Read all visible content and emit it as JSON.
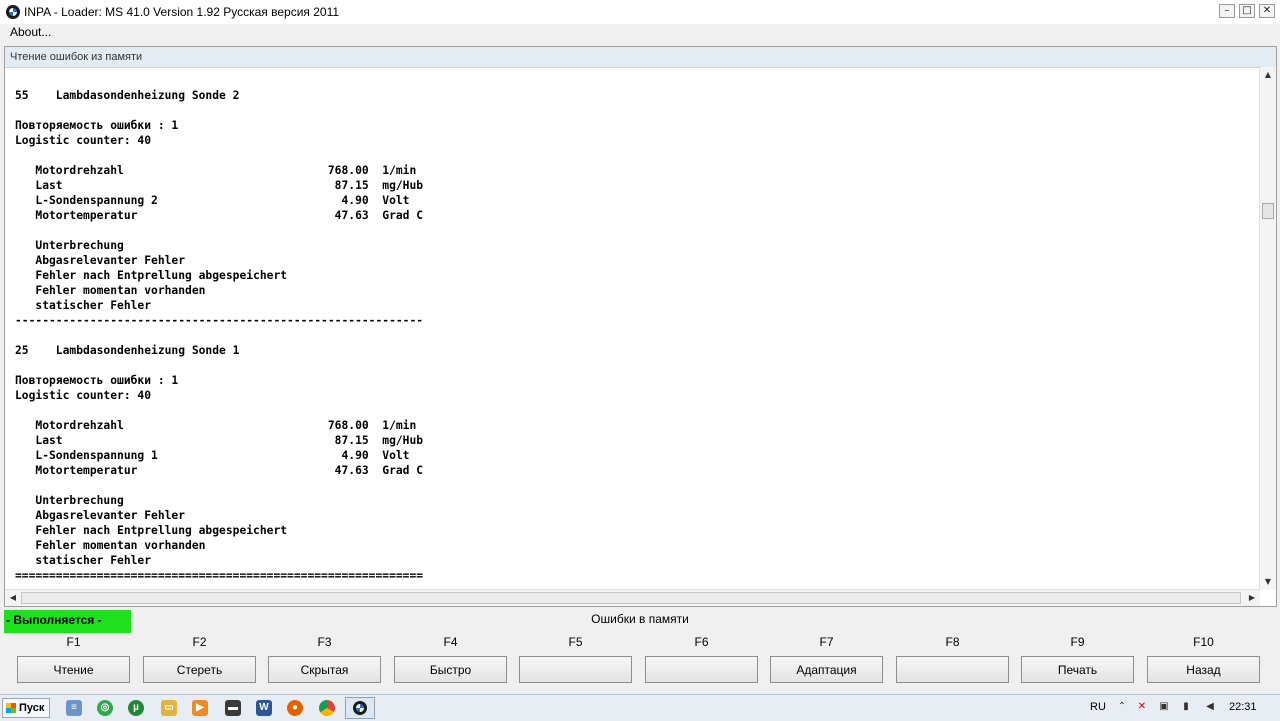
{
  "window": {
    "title": "INPA - Loader:  MS 41.0 Version 1.92  Русская версия 2011"
  },
  "menu": {
    "about": "About..."
  },
  "panel": {
    "title": "Чтение ошибок из памяти"
  },
  "content_lines": [
    "55    Lambdasondenheizung Sonde 2",
    "",
    "Повторяемость ошибки : 1",
    "Logistic counter: 40",
    "",
    "   Motordrehzahl                              768.00  1/min",
    "   Last                                        87.15  mg/Hub",
    "   L-Sondenspannung 2                           4.90  Volt",
    "   Motortemperatur                             47.63  Grad C",
    "",
    "   Unterbrechung",
    "   Abgasrelevanter Fehler",
    "   Fehler nach Entprellung abgespeichert",
    "   Fehler momentan vorhanden",
    "   statischer Fehler",
    "------------------------------------------------------------",
    "",
    "25    Lambdasondenheizung Sonde 1",
    "",
    "Повторяемость ошибки : 1",
    "Logistic counter: 40",
    "",
    "   Motordrehzahl                              768.00  1/min",
    "   Last                                        87.15  mg/Hub",
    "   L-Sondenspannung 1                           4.90  Volt",
    "   Motortemperatur                             47.63  Grad C",
    "",
    "   Unterbrechung",
    "   Abgasrelevanter Fehler",
    "   Fehler nach Entprellung abgespeichert",
    "   Fehler momentan vorhanden",
    "   statischer Fehler",
    "============================================================"
  ],
  "status": {
    "running": "- Выполняется -",
    "title": "Ошибки в памяти",
    "running_color": "#1fe01f"
  },
  "fkeys": [
    {
      "key": "F1",
      "label": "Чтение"
    },
    {
      "key": "F2",
      "label": "Стереть"
    },
    {
      "key": "F3",
      "label": "Скрытая"
    },
    {
      "key": "F4",
      "label": "Быстро"
    },
    {
      "key": "F5",
      "label": ""
    },
    {
      "key": "F6",
      "label": ""
    },
    {
      "key": "F7",
      "label": "Адаптация"
    },
    {
      "key": "F8",
      "label": ""
    },
    {
      "key": "F9",
      "label": "Печать"
    },
    {
      "key": "F10",
      "label": "Назад"
    }
  ],
  "taskbar": {
    "start": "Пуск",
    "apps": [
      "notepad-icon",
      "green-app-icon",
      "utorrent-icon",
      "folder-icon",
      "media-player-icon",
      "terminal-icon",
      "word-icon",
      "firefox-icon",
      "chrome-icon",
      "inpa-icon"
    ],
    "lang": "RU",
    "clock": "22:31"
  }
}
